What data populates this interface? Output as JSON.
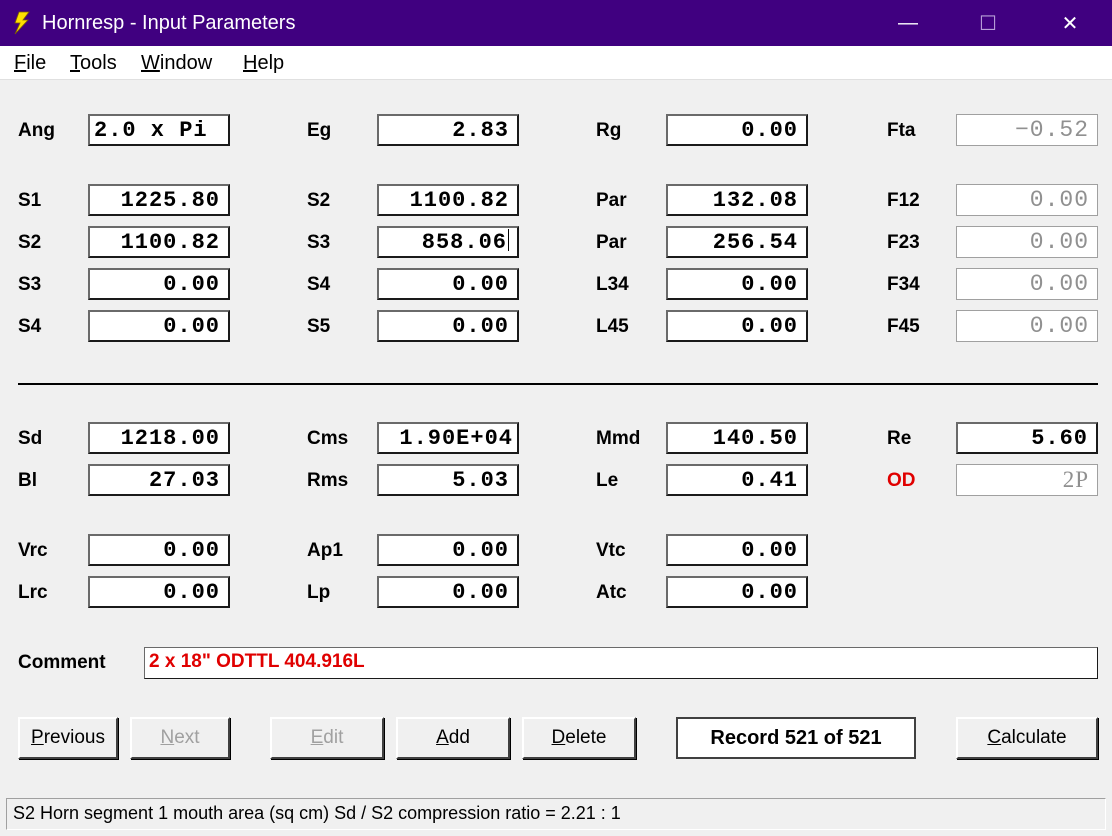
{
  "window": {
    "title": "Hornresp - Input Parameters",
    "minimize": "—",
    "maximize": "☐",
    "close": "✕"
  },
  "menu": [
    {
      "key": "F",
      "rest": "ile"
    },
    {
      "key": "T",
      "rest": "ools"
    },
    {
      "key": "W",
      "rest": "indow"
    },
    {
      "key": "H",
      "rest": "elp"
    }
  ],
  "params": {
    "ang": {
      "label": "Ang",
      "value": "2.0 x Pi"
    },
    "eg": {
      "label": "Eg",
      "value": "2.83"
    },
    "rg": {
      "label": "Rg",
      "value": "0.00"
    },
    "fta": {
      "label": "Fta",
      "value": "−0.52"
    },
    "s1": {
      "label": "S1",
      "value": "1225.80"
    },
    "s2a": {
      "label": "S2",
      "value": "1100.82"
    },
    "par1": {
      "label": "Par",
      "value": "132.08"
    },
    "f12": {
      "label": "F12",
      "value": "0.00"
    },
    "s2b": {
      "label": "S2",
      "value": "1100.82"
    },
    "s3a": {
      "label": "S3",
      "value": "858.06"
    },
    "par2": {
      "label": "Par",
      "value": "256.54"
    },
    "f23": {
      "label": "F23",
      "value": "0.00"
    },
    "s3b": {
      "label": "S3",
      "value": "0.00"
    },
    "s4a": {
      "label": "S4",
      "value": "0.00"
    },
    "l34": {
      "label": "L34",
      "value": "0.00"
    },
    "f34": {
      "label": "F34",
      "value": "0.00"
    },
    "s4b": {
      "label": "S4",
      "value": "0.00"
    },
    "s5": {
      "label": "S5",
      "value": "0.00"
    },
    "l45": {
      "label": "L45",
      "value": "0.00"
    },
    "f45": {
      "label": "F45",
      "value": "0.00"
    },
    "sd": {
      "label": "Sd",
      "value": "1218.00"
    },
    "cms": {
      "label": "Cms",
      "value": "1.90E+04"
    },
    "mmd": {
      "label": "Mmd",
      "value": "140.50"
    },
    "re": {
      "label": "Re",
      "value": "5.60"
    },
    "bl": {
      "label": "Bl",
      "value": "27.03"
    },
    "rms": {
      "label": "Rms",
      "value": "5.03"
    },
    "le": {
      "label": "Le",
      "value": "0.41"
    },
    "od": {
      "label": "OD",
      "value": "2P"
    },
    "vrc": {
      "label": "Vrc",
      "value": "0.00"
    },
    "ap1": {
      "label": "Ap1",
      "value": "0.00"
    },
    "vtc": {
      "label": "Vtc",
      "value": "0.00"
    },
    "lrc": {
      "label": "Lrc",
      "value": "0.00"
    },
    "lp": {
      "label": "Lp",
      "value": "0.00"
    },
    "atc": {
      "label": "Atc",
      "value": "0.00"
    }
  },
  "comment": {
    "label": "Comment",
    "value": "2 x 18\" ODTTL 404.916L"
  },
  "buttons": {
    "previous": {
      "key": "P",
      "rest": "revious"
    },
    "next": {
      "key": "N",
      "rest": "ext"
    },
    "edit": {
      "key": "E",
      "rest": "dit"
    },
    "add": {
      "key": "A",
      "rest": "dd"
    },
    "delete": {
      "key": "D",
      "rest": "elete"
    },
    "record": "Record 521 of 521",
    "calculate": {
      "key": "C",
      "rest": "alculate"
    }
  },
  "status": "S2   Horn segment 1 mouth area  (sq cm)   Sd / S2 compression ratio = 2.21 : 1",
  "colors": {
    "titlebar": "#400080",
    "accent_red": "#e00000"
  }
}
